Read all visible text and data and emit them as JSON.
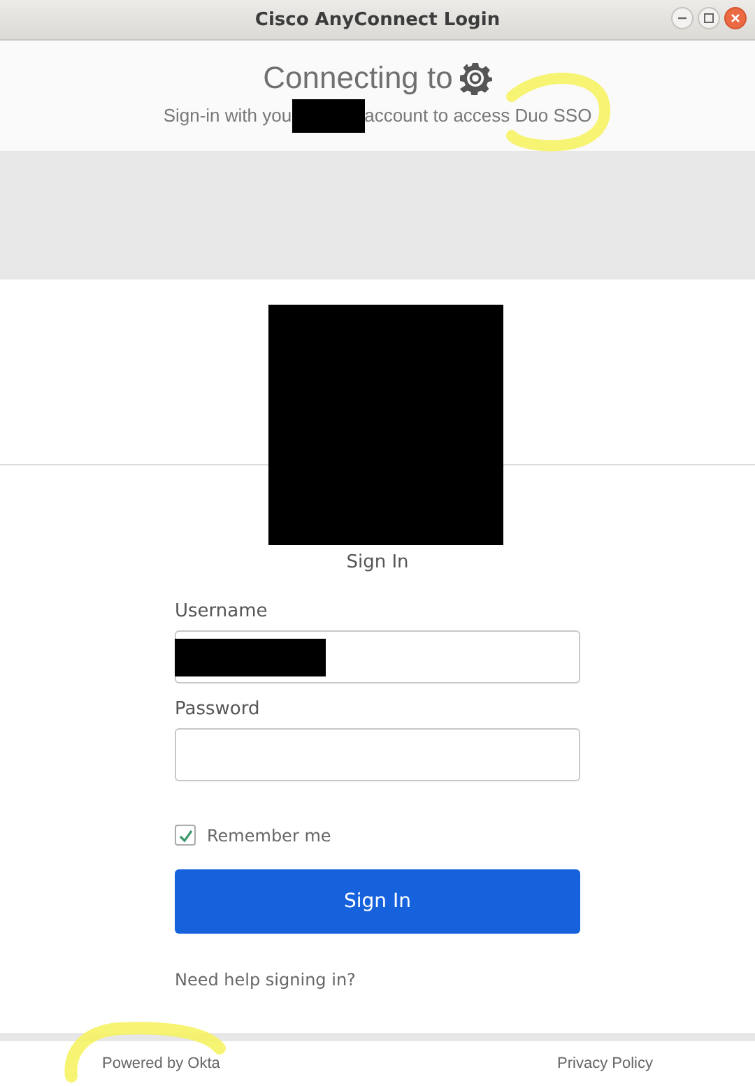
{
  "window": {
    "title": "Cisco AnyConnect Login"
  },
  "header": {
    "heading": "Connecting to",
    "subtitle_start": "Sign-in with you",
    "subtitle_end": "account to access Duo SSO"
  },
  "form": {
    "title": "Sign In",
    "fields": [
      {
        "label": "Username",
        "redacted": true
      },
      {
        "label": "Password",
        "redacted": false
      }
    ],
    "remember": {
      "label": "Remember me",
      "checked": true
    },
    "submit": "Sign In",
    "help": "Need help signing in?"
  },
  "footer": {
    "left": "Powered by Okta",
    "right": "Privacy Policy"
  }
}
